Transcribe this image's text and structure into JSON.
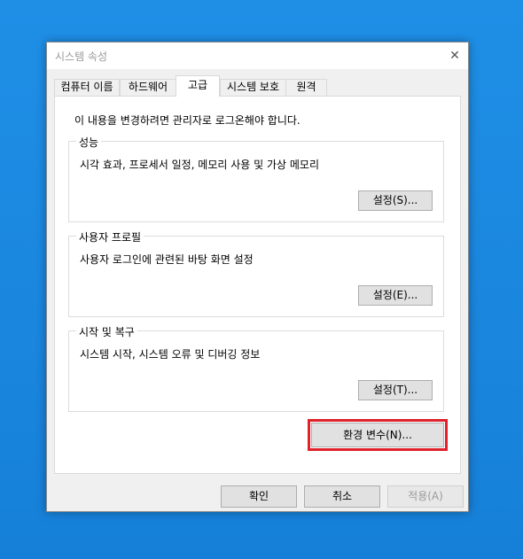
{
  "window": {
    "title": "시스템 속성",
    "close": "✕"
  },
  "tabs": [
    {
      "label": "컴퓨터 이름"
    },
    {
      "label": "하드웨어"
    },
    {
      "label": "고급"
    },
    {
      "label": "시스템 보호"
    },
    {
      "label": "원격"
    }
  ],
  "panel": {
    "notice": "이 내용을 변경하려면 관리자로 로그온해야 합니다.",
    "performance": {
      "title": "성능",
      "description": "시각 효과, 프로세서 일정, 메모리 사용 및 가상 메모리",
      "button": "설정(S)..."
    },
    "user_profiles": {
      "title": "사용자 프로필",
      "description": "사용자 로그인에 관련된 바탕 화면 설정",
      "button": "설정(E)..."
    },
    "startup_recovery": {
      "title": "시작 및 복구",
      "description": "시스템 시작, 시스템 오류 및 디버깅 정보",
      "button": "설정(T)..."
    },
    "env_button": "환경 변수(N)..."
  },
  "footer": {
    "ok": "확인",
    "cancel": "취소",
    "apply": "적용(A)"
  },
  "colors": {
    "highlight": "#e0202a",
    "desktop": "#1a86de"
  }
}
